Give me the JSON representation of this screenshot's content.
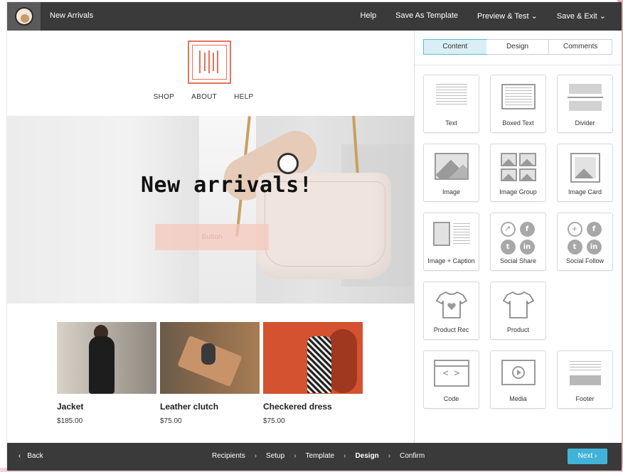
{
  "topbar": {
    "campaign_title": "New Arrivals",
    "help": "Help",
    "save_as_template": "Save As Template",
    "preview_test": "Preview & Test",
    "save_exit": "Save & Exit",
    "chevron": "⌄"
  },
  "email": {
    "nav": [
      "SHOP",
      "ABOUT",
      "HELP"
    ],
    "hero_title": "New arrivals!",
    "hero_button": "Button",
    "products": [
      {
        "name": "Jacket",
        "price": "$185.00"
      },
      {
        "name": "Leather clutch",
        "price": "$75.00"
      },
      {
        "name": "Checkered dress",
        "price": "$75.00"
      }
    ]
  },
  "panel": {
    "tabs": [
      "Content",
      "Design",
      "Comments"
    ],
    "blocks": [
      "Text",
      "Boxed Text",
      "Divider",
      "Image",
      "Image Group",
      "Image Card",
      "Image + Caption",
      "Social Share",
      "Social Follow",
      "Product Rec",
      "Product",
      "Code",
      "Media",
      "Footer"
    ]
  },
  "bottombar": {
    "back": "Back",
    "steps": [
      "Recipients",
      "Setup",
      "Template",
      "Design",
      "Confirm"
    ],
    "next": "Next",
    "chev_left": "‹",
    "chev_right": "›"
  },
  "colors": {
    "accent": "#41b3d8",
    "topbar": "#3a3a3a",
    "logo_orange": "#e8725a",
    "hero_button": "#f5c8be"
  }
}
